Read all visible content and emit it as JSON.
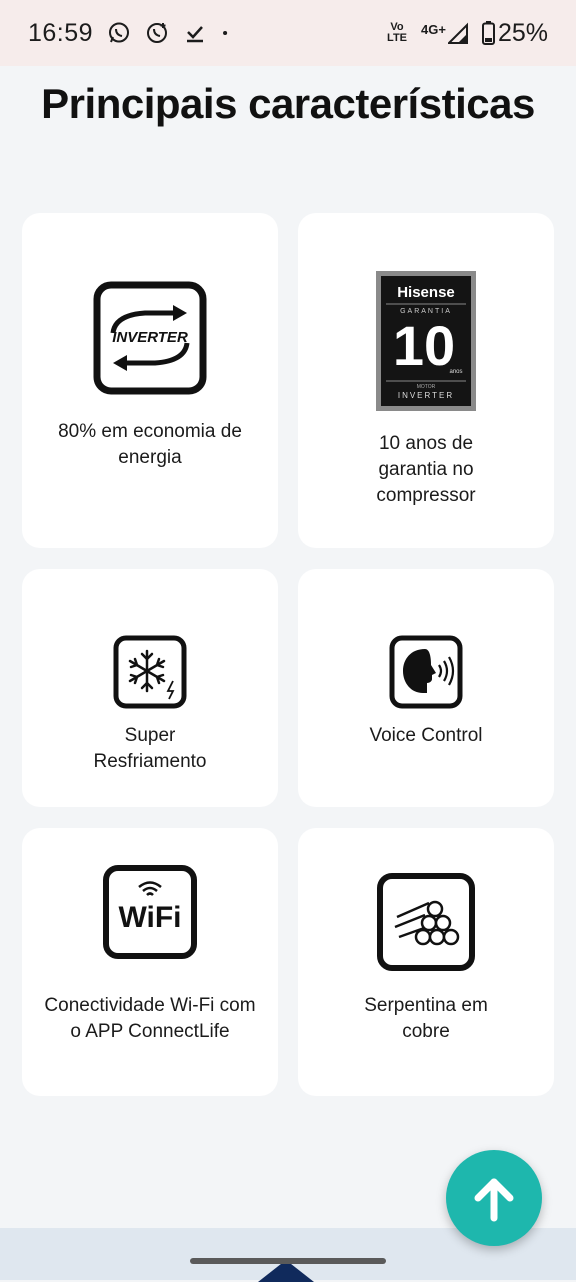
{
  "status_bar": {
    "time": "16:59",
    "network_top": "Vo",
    "network_bottom": "LTE",
    "signal_type": "4G+",
    "battery": "25%",
    "icons": [
      "whatsapp-icon",
      "whatsapp-business-icon",
      "download-done-icon",
      "dot-icon",
      "volte-icon",
      "signal-icon",
      "battery-icon"
    ]
  },
  "page": {
    "title": "Principais características"
  },
  "features": [
    {
      "label": "80% em economia de energia",
      "icon": "inverter-icon"
    },
    {
      "label": "10 anos de garantia no compressor",
      "icon": "hisense-warranty-badge",
      "badge": {
        "brand": "Hisense",
        "top": "GARANTIA",
        "number": "10",
        "unit": "anos",
        "bottom_small": "MOTOR",
        "bottom": "INVERTER"
      }
    },
    {
      "label": "Super Resfriamento",
      "icon": "snowflake-icon"
    },
    {
      "label": "Voice Control",
      "icon": "voice-control-icon"
    },
    {
      "label": "Conectividade Wi-Fi com o APP ConnectLife",
      "icon": "wifi-icon",
      "icon_text": "WiFi"
    },
    {
      "label": "Serpentina em cobre",
      "icon": "copper-pipes-icon"
    }
  ],
  "inverter_text": "INVERTER",
  "fab": {
    "icon": "arrow-up-icon"
  },
  "colors": {
    "fab": "#1eb7ad",
    "background": "#f3f5f7",
    "status_bar": "#f6eceb"
  }
}
